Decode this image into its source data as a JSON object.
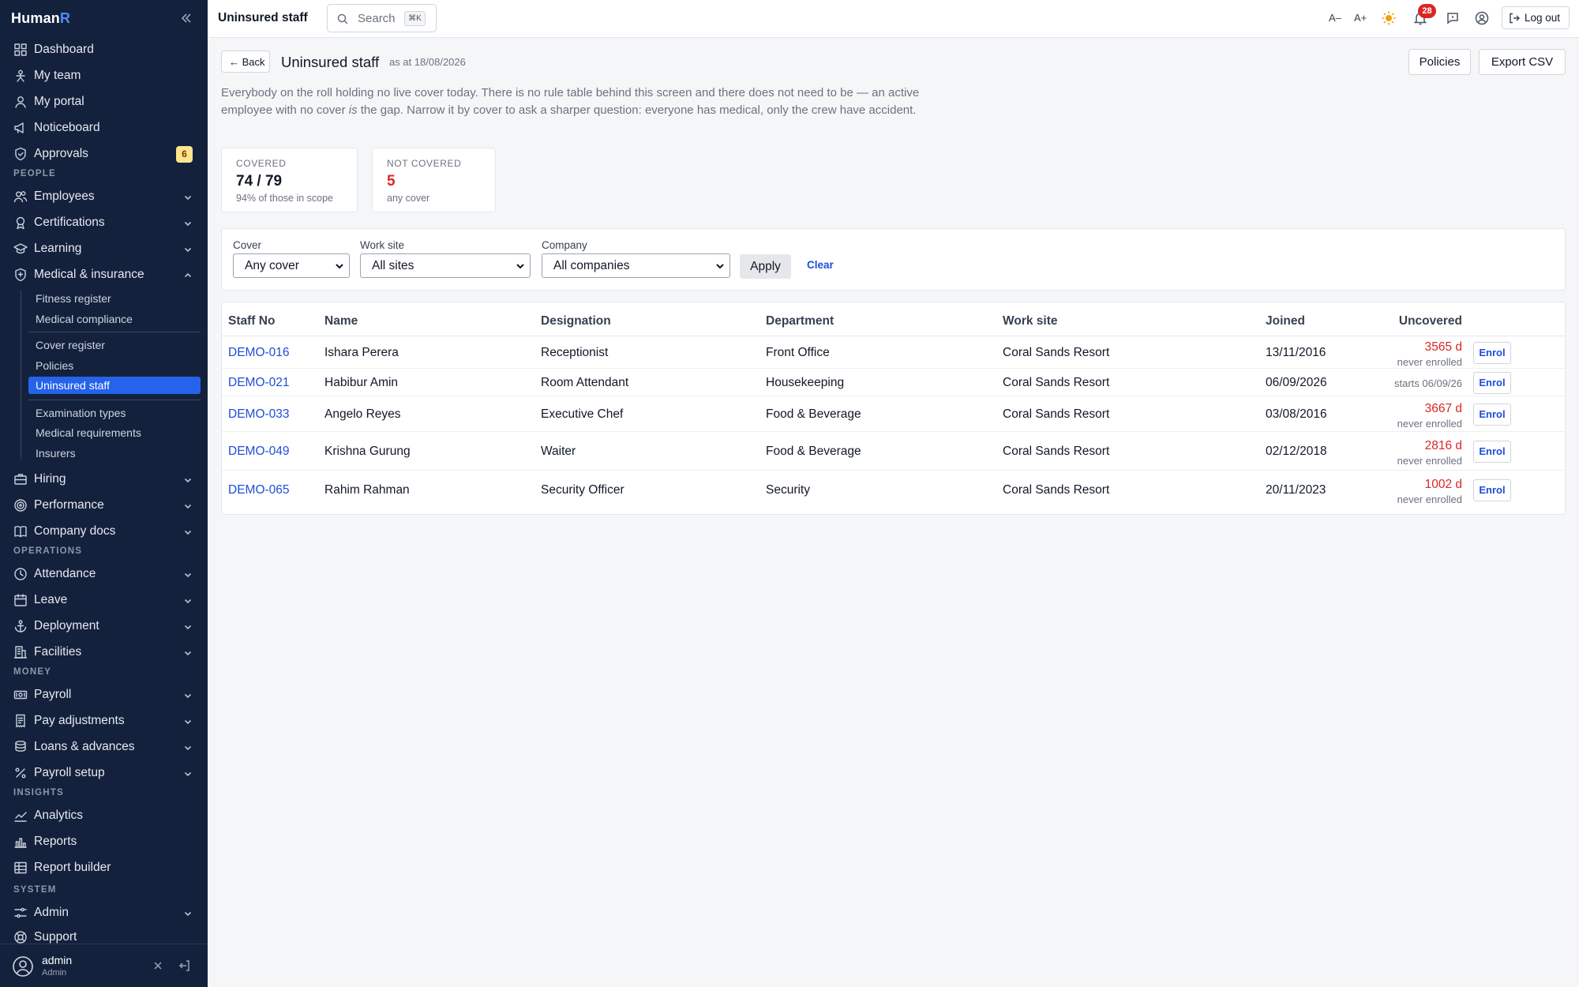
{
  "app": {
    "brand_main": "Human",
    "brand_accent": "R"
  },
  "sidebar": {
    "items": [
      {
        "key": "dashboard",
        "label": "Dashboard",
        "icon": "grid-icon"
      },
      {
        "key": "my-team",
        "label": "My team",
        "icon": "team-icon"
      },
      {
        "key": "my-portal",
        "label": "My portal",
        "icon": "user-icon"
      },
      {
        "key": "noticeboard",
        "label": "Noticeboard",
        "icon": "megaphone-icon"
      },
      {
        "key": "approvals",
        "label": "Approvals",
        "icon": "shield-check-icon",
        "badge": "6"
      }
    ],
    "sections": {
      "people": "PEOPLE",
      "operations": "OPERATIONS",
      "money": "MONEY",
      "insights": "INSIGHTS",
      "system": "SYSTEM"
    },
    "people": [
      {
        "key": "employees",
        "label": "Employees",
        "icon": "users-icon"
      },
      {
        "key": "certifications",
        "label": "Certifications",
        "icon": "award-icon"
      },
      {
        "key": "learning",
        "label": "Learning",
        "icon": "graduation-cap-icon"
      },
      {
        "key": "medical",
        "label": "Medical & insurance",
        "icon": "shield-plus-icon",
        "expanded": true
      }
    ],
    "medical_sub": [
      {
        "key": "fitness-register",
        "label": "Fitness register"
      },
      {
        "key": "medical-compliance",
        "label": "Medical compliance"
      },
      {
        "key": "cover-register",
        "label": "Cover register"
      },
      {
        "key": "policies",
        "label": "Policies"
      },
      {
        "key": "uninsured-staff",
        "label": "Uninsured staff",
        "active": true
      },
      {
        "key": "examination-types",
        "label": "Examination types"
      },
      {
        "key": "medical-requirements",
        "label": "Medical requirements"
      },
      {
        "key": "insurers",
        "label": "Insurers"
      }
    ],
    "people_more": [
      {
        "key": "hiring",
        "label": "Hiring",
        "icon": "briefcase-icon"
      },
      {
        "key": "performance",
        "label": "Performance",
        "icon": "target-icon"
      },
      {
        "key": "company-docs",
        "label": "Company docs",
        "icon": "book-icon"
      }
    ],
    "operations": [
      {
        "key": "attendance",
        "label": "Attendance",
        "icon": "clock-icon"
      },
      {
        "key": "leave",
        "label": "Leave",
        "icon": "calendar-icon"
      },
      {
        "key": "deployment",
        "label": "Deployment",
        "icon": "anchor-icon"
      },
      {
        "key": "facilities",
        "label": "Facilities",
        "icon": "building-icon"
      }
    ],
    "money": [
      {
        "key": "payroll",
        "label": "Payroll",
        "icon": "banknote-icon"
      },
      {
        "key": "pay-adjustments",
        "label": "Pay adjustments",
        "icon": "receipt-icon"
      },
      {
        "key": "loans",
        "label": "Loans & advances",
        "icon": "coins-icon"
      },
      {
        "key": "payroll-setup",
        "label": "Payroll setup",
        "icon": "percent-icon"
      }
    ],
    "insights": [
      {
        "key": "analytics",
        "label": "Analytics",
        "icon": "line-chart-icon"
      },
      {
        "key": "reports",
        "label": "Reports",
        "icon": "bar-chart-icon"
      },
      {
        "key": "report-builder",
        "label": "Report builder",
        "icon": "table-icon"
      }
    ],
    "system": [
      {
        "key": "admin",
        "label": "Admin",
        "icon": "sliders-icon"
      },
      {
        "key": "support",
        "label": "Support",
        "icon": "lifebuoy-icon"
      }
    ],
    "user": {
      "name": "admin",
      "role": "Admin"
    }
  },
  "header": {
    "title": "Uninsured staff",
    "search_placeholder": "Search",
    "search_shortcut": "⌘K",
    "font_smaller": "A–",
    "font_larger": "A+",
    "notification_count": "28",
    "logout_label": "Log out"
  },
  "page": {
    "back_label": "← Back",
    "title": "Uninsured staff",
    "as_at": "as at 18/08/2026",
    "policies_label": "Policies",
    "export_label": "Export CSV",
    "intro_before": "Everybody on the roll holding no live cover today. There is no rule table behind this screen and there does not need to be — an active employee with no cover ",
    "intro_em": "is",
    "intro_after": " the gap. Narrow it by cover to ask a sharper question: everyone has medical, only the crew have accident."
  },
  "stats": {
    "covered": {
      "label": "COVERED",
      "value": "74 / 79",
      "sub": "94% of those in scope"
    },
    "not_covered": {
      "label": "NOT COVERED",
      "value": "5",
      "sub": "any cover"
    }
  },
  "filters": {
    "cover": {
      "label": "Cover",
      "value": "Any cover"
    },
    "site": {
      "label": "Work site",
      "value": "All sites"
    },
    "company": {
      "label": "Company",
      "value": "All companies"
    },
    "apply_label": "Apply",
    "clear_label": "Clear"
  },
  "table": {
    "columns": {
      "staff_no": "Staff No",
      "name": "Name",
      "designation": "Designation",
      "department": "Department",
      "work_site": "Work site",
      "joined": "Joined",
      "uncovered": "Uncovered"
    },
    "enrol_label": "Enrol",
    "rows": [
      {
        "staff_no": "DEMO-016",
        "name": "Ishara Perera",
        "designation": "Receptionist",
        "department": "Front Office",
        "work_site": "Coral Sands Resort",
        "joined": "13/11/2016",
        "uncovered": "3565 d",
        "uncovered_note": "never enrolled"
      },
      {
        "staff_no": "DEMO-021",
        "name": "Habibur Amin",
        "designation": "Room Attendant",
        "department": "Housekeeping",
        "work_site": "Coral Sands Resort",
        "joined": "06/09/2026",
        "uncovered": "",
        "uncovered_note": "starts 06/09/26"
      },
      {
        "staff_no": "DEMO-033",
        "name": "Angelo Reyes",
        "designation": "Executive Chef",
        "department": "Food & Beverage",
        "work_site": "Coral Sands Resort",
        "joined": "03/08/2016",
        "uncovered": "3667 d",
        "uncovered_note": "never enrolled"
      },
      {
        "staff_no": "DEMO-049",
        "name": "Krishna Gurung",
        "designation": "Waiter",
        "department": "Food & Beverage",
        "work_site": "Coral Sands Resort",
        "joined": "02/12/2018",
        "uncovered": "2816 d",
        "uncovered_note": "never enrolled"
      },
      {
        "staff_no": "DEMO-065",
        "name": "Rahim Rahman",
        "designation": "Security Officer",
        "department": "Security",
        "work_site": "Coral Sands Resort",
        "joined": "20/11/2023",
        "uncovered": "1002 d",
        "uncovered_note": "never enrolled"
      }
    ]
  },
  "colors": {
    "sidebar_bg": "#14213d",
    "accent": "#2563eb",
    "danger": "#dc2626",
    "link": "#1d4ed8"
  }
}
